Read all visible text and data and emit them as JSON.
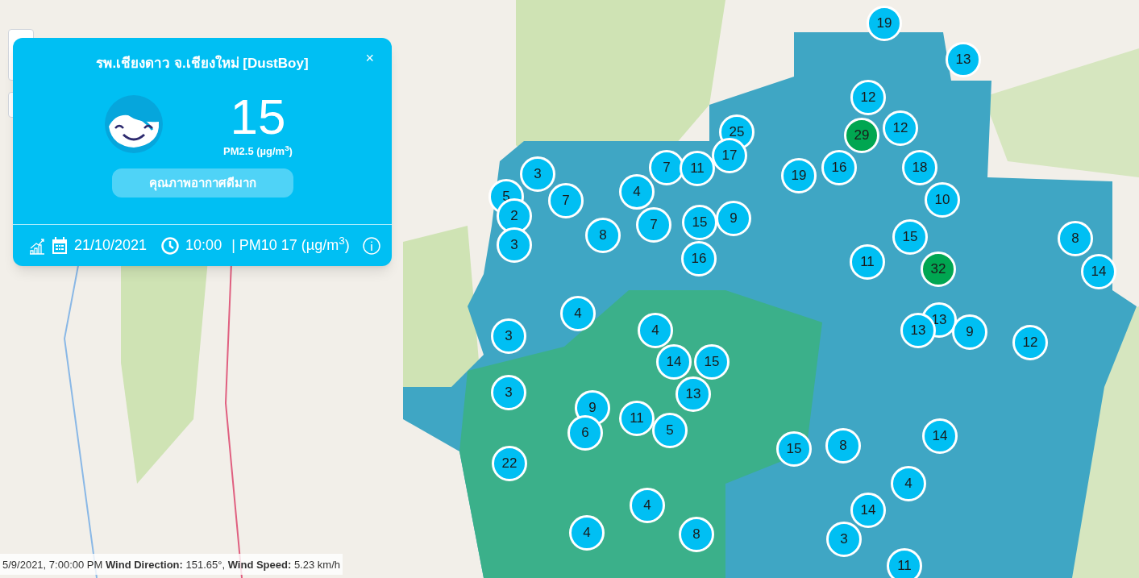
{
  "popup": {
    "title": "รพ.เชียงดาว จ.เชียงใหม่ [DustBoy]",
    "close": "×",
    "value": "15",
    "unit": "PM2.5 (µg/m$^{3}$)",
    "quality": "คุณภาพอากาศดีมาก",
    "date": "21/10/2021",
    "time": "10:00",
    "pm10": "| PM10 17 (µg/m$^{3}$)"
  },
  "markers": [
    {
      "label": "19",
      "color": "#00bff3"
    },
    {
      "label": "13",
      "color": "#00bff3"
    },
    {
      "label": "12",
      "color": "#00bff3"
    },
    {
      "label": "12",
      "color": "#00bff3"
    },
    {
      "label": "29",
      "color": "#00a651"
    },
    {
      "label": "25",
      "color": "#00bff3"
    },
    {
      "label": "17",
      "color": "#00bff3"
    },
    {
      "label": "7",
      "color": "#00bff3"
    },
    {
      "label": "11",
      "color": "#00bff3"
    },
    {
      "label": "3",
      "color": "#00bff3"
    },
    {
      "label": "19",
      "color": "#00bff3"
    },
    {
      "label": "16",
      "color": "#00bff3"
    },
    {
      "label": "18",
      "color": "#00bff3"
    },
    {
      "label": "5",
      "color": "#00bff3"
    },
    {
      "label": "7",
      "color": "#00bff3"
    },
    {
      "label": "4",
      "color": "#00bff3"
    },
    {
      "label": "10",
      "color": "#00bff3"
    },
    {
      "label": "2",
      "color": "#00bff3"
    },
    {
      "label": "9",
      "color": "#00bff3"
    },
    {
      "label": "7",
      "color": "#00bff3"
    },
    {
      "label": "15",
      "color": "#00bff3"
    },
    {
      "label": "8",
      "color": "#00bff3"
    },
    {
      "label": "3",
      "color": "#00bff3"
    },
    {
      "label": "15",
      "color": "#00bff3"
    },
    {
      "label": "8",
      "color": "#00bff3"
    },
    {
      "label": "16",
      "color": "#00bff3"
    },
    {
      "label": "11",
      "color": "#00bff3"
    },
    {
      "label": "32",
      "color": "#00a651"
    },
    {
      "label": "14",
      "color": "#00bff3"
    },
    {
      "label": "4",
      "color": "#00bff3"
    },
    {
      "label": "3",
      "color": "#00bff3"
    },
    {
      "label": "4",
      "color": "#00bff3"
    },
    {
      "label": "13",
      "color": "#00bff3"
    },
    {
      "label": "13",
      "color": "#00bff3"
    },
    {
      "label": "9",
      "color": "#00bff3"
    },
    {
      "label": "12",
      "color": "#00bff3"
    },
    {
      "label": "14",
      "color": "#00bff3"
    },
    {
      "label": "15",
      "color": "#00bff3"
    },
    {
      "label": "3",
      "color": "#00bff3"
    },
    {
      "label": "13",
      "color": "#00bff3"
    },
    {
      "label": "9",
      "color": "#00bff3"
    },
    {
      "label": "6",
      "color": "#00bff3"
    },
    {
      "label": "11",
      "color": "#00bff3"
    },
    {
      "label": "5",
      "color": "#00bff3"
    },
    {
      "label": "22",
      "color": "#00bff3"
    },
    {
      "label": "14",
      "color": "#00bff3"
    },
    {
      "label": "15",
      "color": "#00bff3"
    },
    {
      "label": "8",
      "color": "#00bff3"
    },
    {
      "label": "4",
      "color": "#00bff3"
    },
    {
      "label": "14",
      "color": "#00bff3"
    },
    {
      "label": "4",
      "color": "#00bff3"
    },
    {
      "label": "4",
      "color": "#00bff3"
    },
    {
      "label": "8",
      "color": "#00bff3"
    },
    {
      "label": "3",
      "color": "#00bff3"
    },
    {
      "label": "11",
      "color": "#00bff3"
    }
  ],
  "status_bar": "5/9/2021, 7:00:00 PM **Wind Direction:** 151.65°, **Wind Speed:** 5.23 km/h"
}
